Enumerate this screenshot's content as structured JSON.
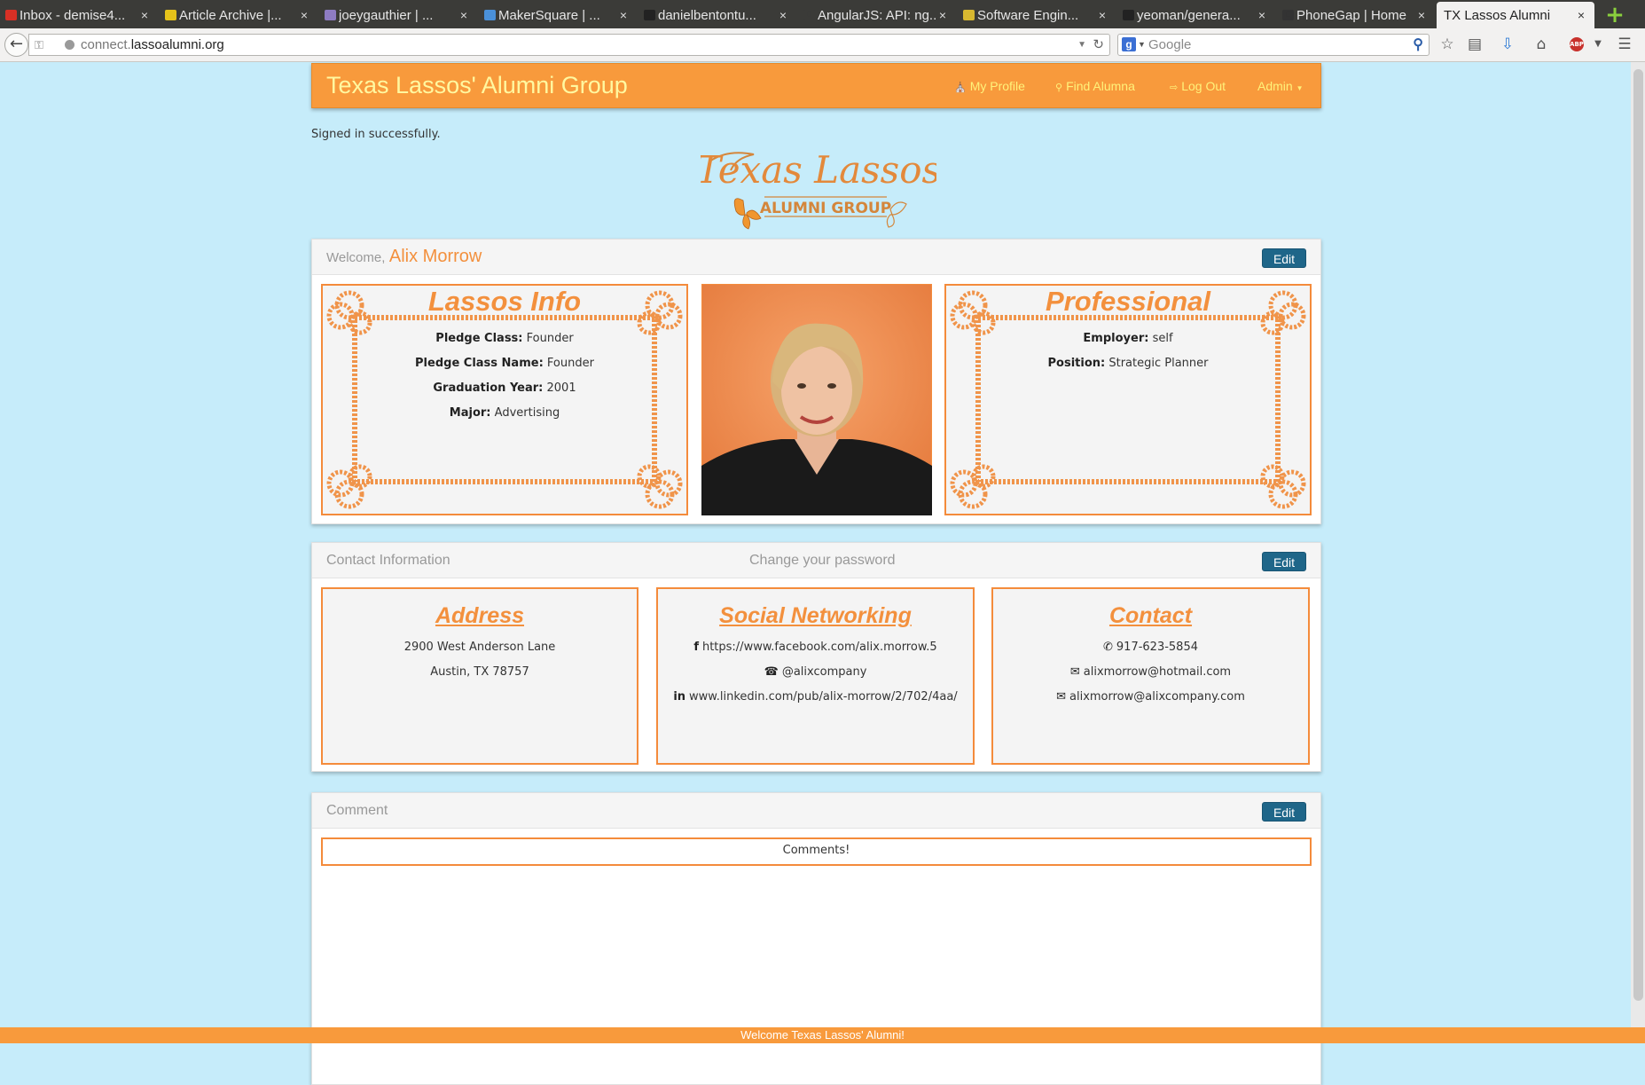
{
  "browser": {
    "tabs": [
      {
        "title": "Inbox - demise4...",
        "favicon": "gmail-icon",
        "color": "#d93025"
      },
      {
        "title": "Article Archive |...",
        "favicon": "codrops-icon",
        "color": "#e5c21a"
      },
      {
        "title": "joeygauthier | ...",
        "favicon": "hash-icon",
        "color": "#8e7cc3"
      },
      {
        "title": "MakerSquare | ...",
        "favicon": "mail-icon",
        "color": "#4a90d9"
      },
      {
        "title": "danielbentontu...",
        "favicon": "github-icon",
        "color": "#222222"
      },
      {
        "title": "AngularJS: API: ng...",
        "favicon": "angular-icon",
        "color": "#3b3b38"
      },
      {
        "title": "Software Engin...",
        "favicon": "hacker-icon",
        "color": "#d8b830"
      },
      {
        "title": "yeoman/genera...",
        "favicon": "github-icon",
        "color": "#222222"
      },
      {
        "title": "PhoneGap | Home",
        "favicon": "phonegap-icon",
        "color": "#333333"
      },
      {
        "title": "TX Lassos Alumni",
        "favicon": "",
        "color": "",
        "active": true
      }
    ],
    "url_prefix": "connect.",
    "url_domain": "lassoalumni.org",
    "search_placeholder": "Google"
  },
  "site": {
    "brand": "Texas Lassos' Alumni Group",
    "nav": {
      "my_profile": "My Profile",
      "find_alumna": "Find Alumna",
      "log_out": "Log Out",
      "admin": "Admin"
    },
    "flash": "Signed in successfully.",
    "logo": {
      "script": "Texas Lassos",
      "sub": "ALUMNI GROUP"
    },
    "footer": "Welcome Texas Lassos' Alumni!",
    "accent": "#f89a3c",
    "button_color": "#1f6689"
  },
  "profile": {
    "welcome": "Welcome,",
    "name": "Alix Morrow",
    "edit": "Edit",
    "lassos_info": {
      "title": "Lassos Info",
      "rows": [
        {
          "label": "Pledge Class:",
          "value": "Founder"
        },
        {
          "label": "Pledge Class Name:",
          "value": "Founder"
        },
        {
          "label": "Graduation Year:",
          "value": "2001"
        },
        {
          "label": "Major:",
          "value": "Advertising"
        }
      ]
    },
    "professional": {
      "title": "Professional",
      "rows": [
        {
          "label": "Employer:",
          "value": "self"
        },
        {
          "label": "Position:",
          "value": "Strategic Planner"
        }
      ]
    }
  },
  "contact": {
    "title": "Contact Information",
    "change_password": "Change your password",
    "edit": "Edit",
    "address": {
      "title": "Address",
      "line1": "2900 West Anderson Lane",
      "line2": "Austin, TX 78757"
    },
    "social": {
      "title": "Social Networking",
      "facebook": "https://www.facebook.com/alix.morrow.5",
      "twitter": "@alixcompany",
      "linkedin": "www.linkedin.com/pub/alix-morrow/2/702/4aa/"
    },
    "contact": {
      "title": "Contact",
      "phone": "917-623-5854",
      "email1": "alixmorrow@hotmail.com",
      "email2": "alixmorrow@alixcompany.com"
    }
  },
  "comment": {
    "title": "Comment",
    "edit": "Edit",
    "text": "Comments!"
  }
}
